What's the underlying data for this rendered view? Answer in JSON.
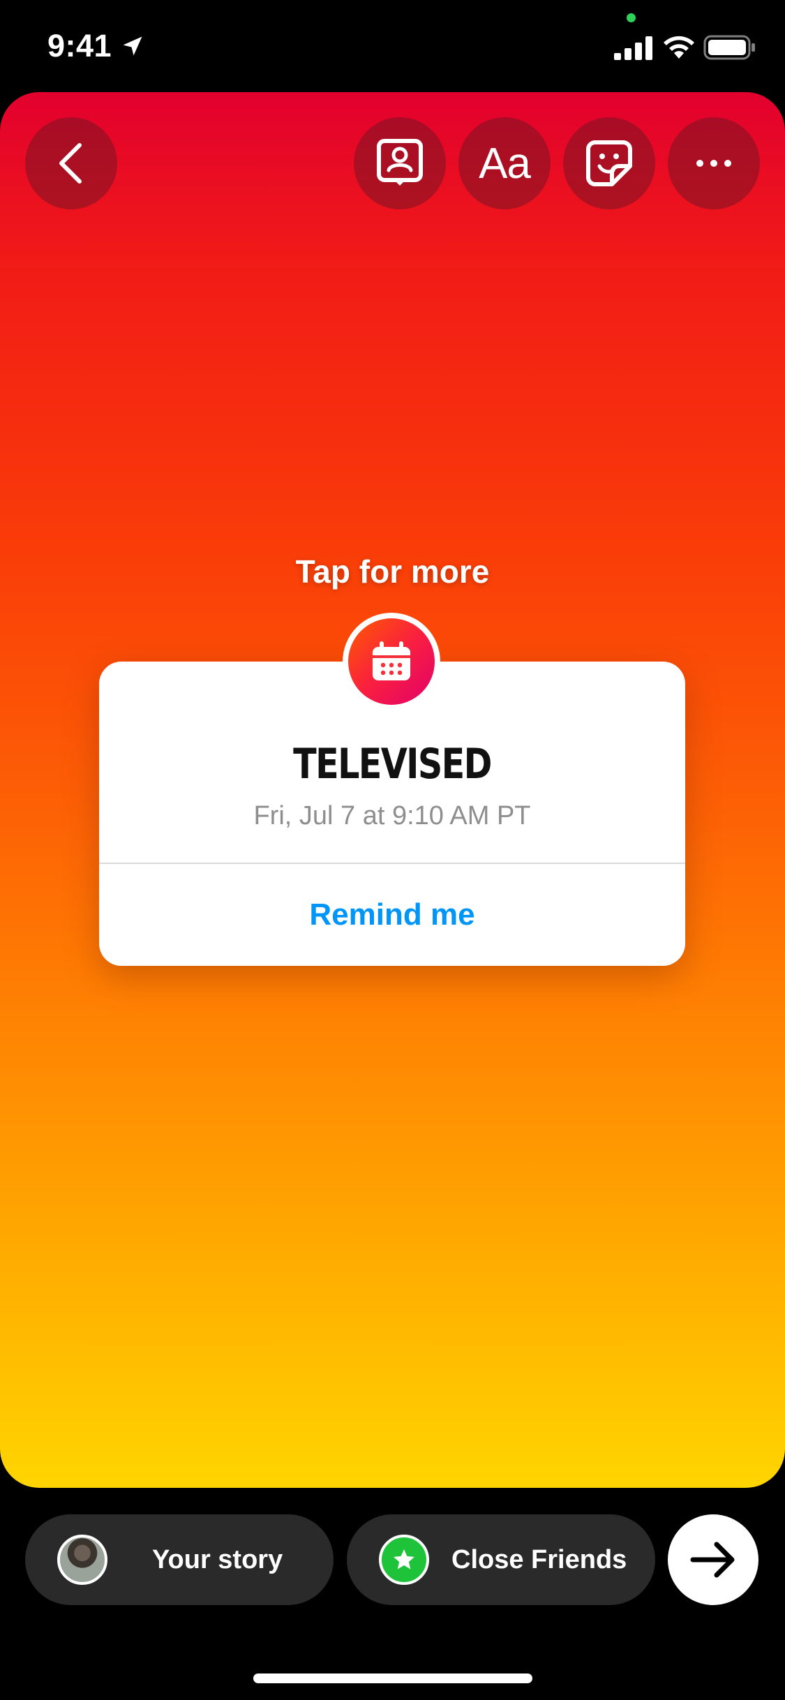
{
  "status_bar": {
    "time": "9:41"
  },
  "toolbar": {
    "back_icon": "chevron-left-icon",
    "mention_icon": "mention-icon",
    "text_label": "Aa",
    "sticker_icon": "sticker-icon",
    "more_icon": "more-icon"
  },
  "story": {
    "tap_hint": "Tap for more",
    "event": {
      "icon": "calendar-icon",
      "title": "TELEVISED",
      "date": "Fri, Jul 7 at 9:10 AM PT",
      "remind_label": "Remind me"
    }
  },
  "share": {
    "your_story_label": "Your story",
    "close_friends_label": "Close Friends",
    "next_icon": "arrow-right-icon"
  },
  "colors": {
    "accent_blue": "#0095f6",
    "close_friends_green": "#1ec33a",
    "gradient_top": "#e2002e",
    "gradient_bottom": "#ffd500"
  }
}
